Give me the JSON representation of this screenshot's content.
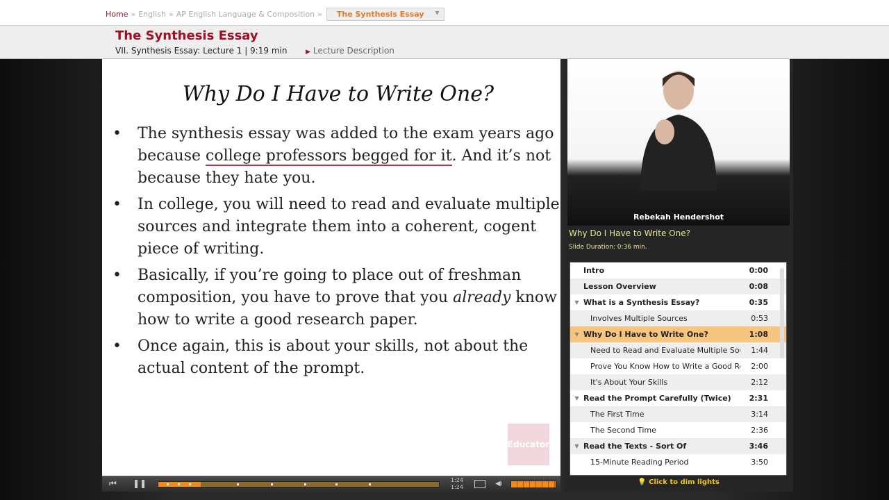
{
  "breadcrumb": {
    "items": [
      "Home",
      "English",
      "AP English Language & Composition"
    ],
    "current": "The Synthesis Essay"
  },
  "header": {
    "title": "The Synthesis Essay",
    "subtitle": "VII. Synthesis Essay: Lecture 1 | 9:19 min",
    "description_link": "Lecture Description"
  },
  "slide": {
    "title": "Why Do I Have to Write One?",
    "bullets": [
      {
        "pre": "The synthesis essay was added to the exam years ago because ",
        "underlined": "college professors begged for it",
        "post": ". And it’s not because they hate you."
      },
      {
        "pre": "In college, you will need to read and evaluate multiple sources and integrate them into a coherent, cogent piece of writing.",
        "underlined": "",
        "post": ""
      },
      {
        "pre": "Basically, if you’re going to place out of freshman composition, you have to prove that you ",
        "italic": "already",
        "post": " know how to write a good research paper."
      },
      {
        "pre": "Once again, this is about your skills, not about the actual content of the prompt.",
        "underlined": "",
        "post": ""
      }
    ],
    "logo": "Educator"
  },
  "player": {
    "elapsed": "1:24",
    "total": "1:24",
    "progress_percent": 15,
    "volume_percent": 100
  },
  "video": {
    "presenter": "Rebekah Hendershot",
    "slide_title": "Why Do I Have to Write One?",
    "slide_duration": "Slide Duration: 0:36 min."
  },
  "lessons": [
    {
      "title": "Intro",
      "time": "0:00",
      "type": "h"
    },
    {
      "title": "Lesson Overview",
      "time": "0:08",
      "type": "h"
    },
    {
      "title": "What is a Synthesis Essay?",
      "time": "0:35",
      "type": "h",
      "tri": true
    },
    {
      "title": "Involves Multiple Sources",
      "time": "0:53",
      "type": "sub"
    },
    {
      "title": "Why Do I Have to Write One?",
      "time": "1:08",
      "type": "h",
      "tri": true,
      "active": true
    },
    {
      "title": "Need to Read and Evaluate Multiple Sources in",
      "time": "1:44",
      "type": "sub"
    },
    {
      "title": "Prove You Know How to Write a Good Research",
      "time": "2:00",
      "type": "sub"
    },
    {
      "title": "It's About Your Skills",
      "time": "2:12",
      "type": "sub"
    },
    {
      "title": "Read the Prompt Carefully (Twice)",
      "time": "2:31",
      "type": "h",
      "tri": true
    },
    {
      "title": "The First Time",
      "time": "3:14",
      "type": "sub"
    },
    {
      "title": "The Second Time",
      "time": "2:36",
      "type": "sub"
    },
    {
      "title": "Read the Texts - Sort Of",
      "time": "3:46",
      "type": "h",
      "tri": true
    },
    {
      "title": "15-Minute Reading Period",
      "time": "3:50",
      "type": "sub"
    }
  ],
  "dim_lights": "Click to dim lights",
  "colors": {
    "brand": "#a01025",
    "accent": "#f28a1a",
    "active_row": "#f7c57e"
  }
}
